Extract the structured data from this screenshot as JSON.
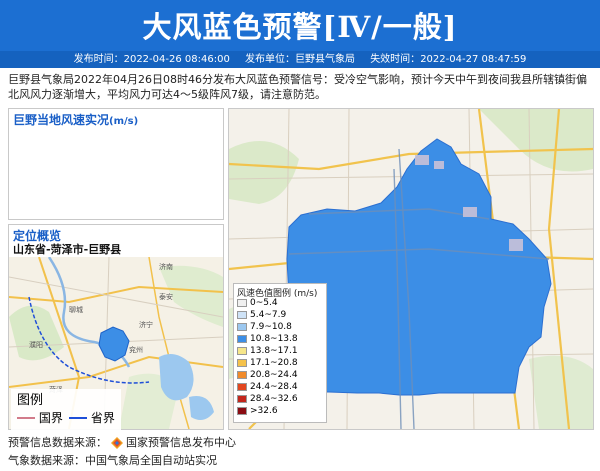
{
  "header": {
    "title": "大风蓝色预警[Ⅳ/一般]",
    "issue_time_label": "发布时间：",
    "issue_time": "2022-04-26 08:46:00",
    "issuer_label": "发布单位：",
    "issuer": "巨野县气象局",
    "expire_label": "失效时间：",
    "expire_time": "2022-04-27 08:47:59"
  },
  "description": "巨野县气象局2022年04月26日08时46分发布大风蓝色预警信号：受冷空气影响，预计今天中午到夜间我县所辖镇街偏北风风力逐渐增大，平均风力可达4～5级阵风7级，请注意防范。",
  "wind_panel": {
    "title": "巨野当地风速实况",
    "unit": "(m/s)"
  },
  "location_panel": {
    "title": "定位概览",
    "region": "山东省-菏泽市-巨野县"
  },
  "map_legend": {
    "title": "图例",
    "items": [
      {
        "label": "国界",
        "color": "#d27b8a"
      },
      {
        "label": "省界",
        "color": "#1f4fd8"
      }
    ]
  },
  "wind_legend": {
    "title": "风速色值图例 (m/s)",
    "items": [
      {
        "label": "0~5.4",
        "color": "#f0f0f0"
      },
      {
        "label": "5.4~7.9",
        "color": "#cfe3f7"
      },
      {
        "label": "7.9~10.8",
        "color": "#9cc8f0"
      },
      {
        "label": "10.8~13.8",
        "color": "#3c8ee6"
      },
      {
        "label": "13.8~17.1",
        "color": "#f6e68a"
      },
      {
        "label": "17.1~20.8",
        "color": "#f5c24b"
      },
      {
        "label": "20.8~24.4",
        "color": "#f08a2a"
      },
      {
        "label": "24.4~28.4",
        "color": "#e2461f"
      },
      {
        "label": "28.4~32.6",
        "color": "#c3261c"
      },
      {
        "label": ">32.6",
        "color": "#8a0c12"
      }
    ]
  },
  "footer": {
    "source_label": "预警信息数据来源：",
    "source": "国家预警信息发布中心",
    "weather_label": "气象数据来源：",
    "weather": "中国气象局全国自动站实况"
  },
  "colors": {
    "header_bg": "#1c6fd2",
    "accent": "#1a5fc7",
    "area_fill": "#3c8ee6"
  }
}
